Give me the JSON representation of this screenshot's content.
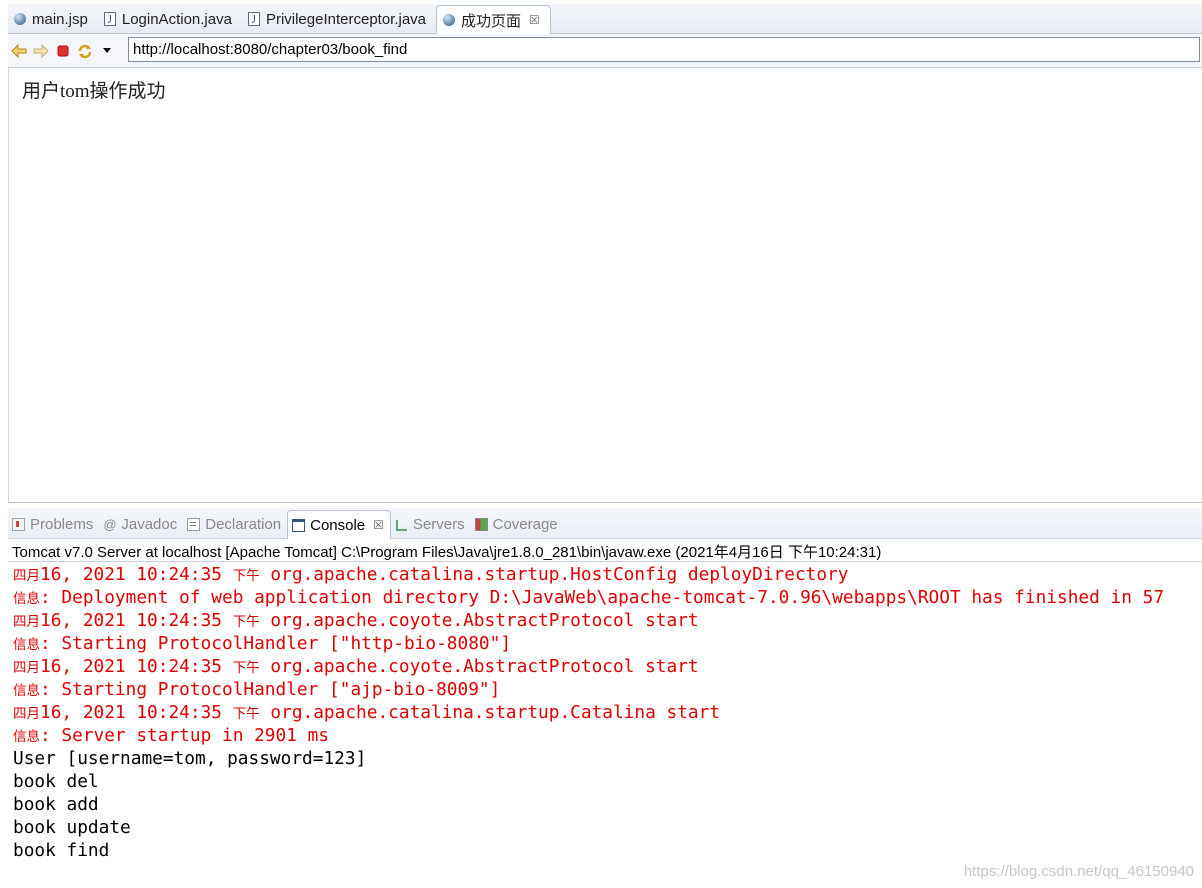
{
  "editor_tabs": [
    {
      "label": "main.jsp",
      "icon": "globe-icon"
    },
    {
      "label": "LoginAction.java",
      "icon": "java-file-icon"
    },
    {
      "label": "PrivilegeInterceptor.java",
      "icon": "java-file-icon"
    },
    {
      "label": "成功页面",
      "icon": "globe-icon",
      "active": true,
      "close": "☒"
    }
  ],
  "browser": {
    "url": "http://localhost:8080/chapter03/book_find",
    "content": "用户tom操作成功"
  },
  "views": {
    "tabs": [
      {
        "label": "Problems",
        "icon": "problems-icon"
      },
      {
        "label": "Javadoc",
        "icon": "javadoc-icon"
      },
      {
        "label": "Declaration",
        "icon": "declaration-icon"
      },
      {
        "label": "Console",
        "icon": "console-icon",
        "active": true,
        "close": "☒"
      },
      {
        "label": "Servers",
        "icon": "servers-icon"
      },
      {
        "label": "Coverage",
        "icon": "coverage-icon"
      }
    ]
  },
  "console": {
    "header": "Tomcat v7.0 Server at localhost [Apache Tomcat] C:\\Program Files\\Java\\jre1.8.0_281\\bin\\javaw.exe (2021年4月16日 下午10:24:31)",
    "lines": [
      {
        "color": "red",
        "segments": [
          {
            "cjk": "四月"
          },
          {
            "text": "16, 2021 10:24:35 "
          },
          {
            "cjk": "下午"
          },
          {
            "text": " org.apache.catalina.startup.HostConfig deployDirectory"
          }
        ]
      },
      {
        "color": "red",
        "segments": [
          {
            "cjk": "信息"
          },
          {
            "text": ": Deployment of web application directory D:\\JavaWeb\\apache-tomcat-7.0.96\\webapps\\ROOT has finished in 57"
          }
        ]
      },
      {
        "color": "red",
        "segments": [
          {
            "cjk": "四月"
          },
          {
            "text": "16, 2021 10:24:35 "
          },
          {
            "cjk": "下午"
          },
          {
            "text": " org.apache.coyote.AbstractProtocol start"
          }
        ]
      },
      {
        "color": "red",
        "segments": [
          {
            "cjk": "信息"
          },
          {
            "text": ": Starting ProtocolHandler [\"http-bio-8080\"]"
          }
        ]
      },
      {
        "color": "red",
        "segments": [
          {
            "cjk": "四月"
          },
          {
            "text": "16, 2021 10:24:35 "
          },
          {
            "cjk": "下午"
          },
          {
            "text": " org.apache.coyote.AbstractProtocol start"
          }
        ]
      },
      {
        "color": "red",
        "segments": [
          {
            "cjk": "信息"
          },
          {
            "text": ": Starting ProtocolHandler [\"ajp-bio-8009\"]"
          }
        ]
      },
      {
        "color": "red",
        "segments": [
          {
            "cjk": "四月"
          },
          {
            "text": "16, 2021 10:24:35 "
          },
          {
            "cjk": "下午"
          },
          {
            "text": " org.apache.catalina.startup.Catalina start"
          }
        ]
      },
      {
        "color": "red",
        "segments": [
          {
            "cjk": "信息"
          },
          {
            "text": ": Server startup in 2901 ms"
          }
        ]
      },
      {
        "color": "black",
        "segments": [
          {
            "text": "User [username=tom, password=123]"
          }
        ]
      },
      {
        "color": "black",
        "segments": [
          {
            "text": "book del"
          }
        ]
      },
      {
        "color": "black",
        "segments": [
          {
            "text": "book add"
          }
        ]
      },
      {
        "color": "black",
        "segments": [
          {
            "text": "book update"
          }
        ]
      },
      {
        "color": "black",
        "segments": [
          {
            "text": "book find"
          }
        ]
      }
    ]
  },
  "watermark": "https://blog.csdn.net/qq_46150940",
  "colors": {
    "error_red": "#e00000",
    "accent_blue": "#35557a"
  }
}
